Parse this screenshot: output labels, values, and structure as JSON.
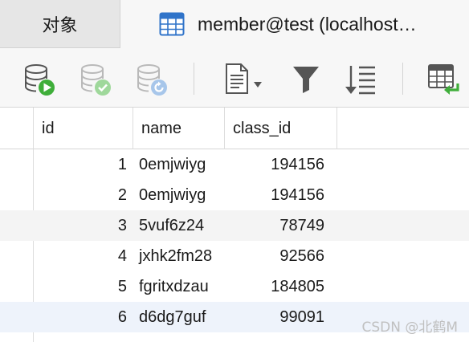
{
  "tabs": {
    "objects_label": "对象",
    "active_label": "member@test (localhost…"
  },
  "toolbar": {
    "icons": [
      "run-query-icon",
      "commit-icon",
      "rollback-icon",
      "text-view-icon",
      "filter-icon",
      "sort-icon",
      "import-icon"
    ]
  },
  "table": {
    "columns": [
      "id",
      "name",
      "class_id"
    ],
    "rows": [
      {
        "id": "1",
        "name": "0emjwiyg",
        "class_id": "194156"
      },
      {
        "id": "2",
        "name": "0emjwiyg",
        "class_id": "194156"
      },
      {
        "id": "3",
        "name": "5vuf6z24",
        "class_id": "78749"
      },
      {
        "id": "4",
        "name": "jxhk2fm28",
        "class_id": "92566"
      },
      {
        "id": "5",
        "name": "fgritxdzau",
        "class_id": "184805"
      },
      {
        "id": "6",
        "name": "d6dg7guf",
        "class_id": "99091"
      }
    ]
  },
  "watermark": "CSDN @北鹤M",
  "colors": {
    "green": "#3fae3a",
    "blue": "#2f73c9",
    "gray_icon": "#6f6f6f"
  }
}
